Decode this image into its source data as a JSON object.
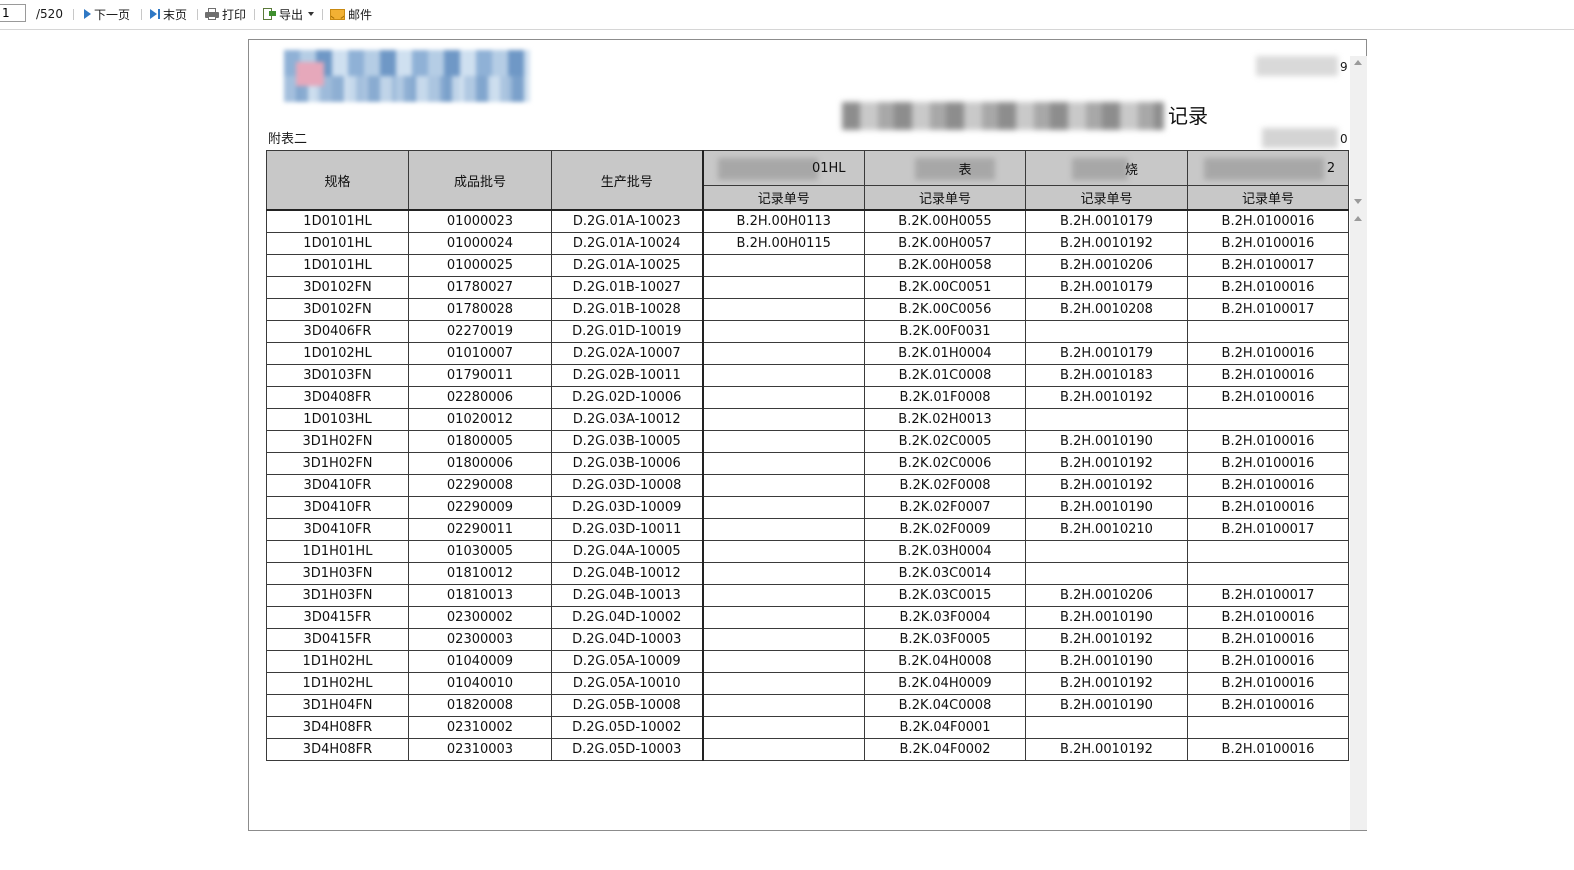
{
  "toolbar": {
    "page_input_value": "1",
    "page_total": "/520",
    "next_label": "下一页",
    "last_label": "末页",
    "print_label": "打印",
    "export_label": "导出",
    "mail_label": "邮件",
    "icons": [
      "next-page-icon",
      "last-page-icon",
      "printer-icon",
      "export-icon",
      "dropdown-caret-icon",
      "mail-icon"
    ],
    "accent_color": "#2f78c4"
  },
  "report": {
    "title_suffix": "记录",
    "page_mark_top": "9",
    "page_mark_bottom": "0",
    "attachment_label": "附表二",
    "header": {
      "spec": "规格",
      "product_batch": "成品批号",
      "production_batch": "生产批号",
      "group1_suffix": "01HL",
      "group2_suffix": "表",
      "group3_suffix": "烧",
      "group4_suffix": "2",
      "record_no": "记录单号"
    },
    "rows": [
      [
        "1D0101HL",
        "01000023",
        "D.2G.01A-10023",
        "B.2H.00H0113",
        "B.2K.00H0055",
        "B.2H.0010179",
        "B.2H.0100016"
      ],
      [
        "1D0101HL",
        "01000024",
        "D.2G.01A-10024",
        "B.2H.00H0115",
        "B.2K.00H0057",
        "B.2H.0010192",
        "B.2H.0100016"
      ],
      [
        "1D0101HL",
        "01000025",
        "D.2G.01A-10025",
        "",
        "B.2K.00H0058",
        "B.2H.0010206",
        "B.2H.0100017"
      ],
      [
        "3D0102FN",
        "01780027",
        "D.2G.01B-10027",
        "",
        "B.2K.00C0051",
        "B.2H.0010179",
        "B.2H.0100016"
      ],
      [
        "3D0102FN",
        "01780028",
        "D.2G.01B-10028",
        "",
        "B.2K.00C0056",
        "B.2H.0010208",
        "B.2H.0100017"
      ],
      [
        "3D0406FR",
        "02270019",
        "D.2G.01D-10019",
        "",
        "B.2K.00F0031",
        "",
        ""
      ],
      [
        "1D0102HL",
        "01010007",
        "D.2G.02A-10007",
        "",
        "B.2K.01H0004",
        "B.2H.0010179",
        "B.2H.0100016"
      ],
      [
        "3D0103FN",
        "01790011",
        "D.2G.02B-10011",
        "",
        "B.2K.01C0008",
        "B.2H.0010183",
        "B.2H.0100016"
      ],
      [
        "3D0408FR",
        "02280006",
        "D.2G.02D-10006",
        "",
        "B.2K.01F0008",
        "B.2H.0010192",
        "B.2H.0100016"
      ],
      [
        "1D0103HL",
        "01020012",
        "D.2G.03A-10012",
        "",
        "B.2K.02H0013",
        "",
        ""
      ],
      [
        "3D1H02FN",
        "01800005",
        "D.2G.03B-10005",
        "",
        "B.2K.02C0005",
        "B.2H.0010190",
        "B.2H.0100016"
      ],
      [
        "3D1H02FN",
        "01800006",
        "D.2G.03B-10006",
        "",
        "B.2K.02C0006",
        "B.2H.0010192",
        "B.2H.0100016"
      ],
      [
        "3D0410FR",
        "02290008",
        "D.2G.03D-10008",
        "",
        "B.2K.02F0008",
        "B.2H.0010192",
        "B.2H.0100016"
      ],
      [
        "3D0410FR",
        "02290009",
        "D.2G.03D-10009",
        "",
        "B.2K.02F0007",
        "B.2H.0010190",
        "B.2H.0100016"
      ],
      [
        "3D0410FR",
        "02290011",
        "D.2G.03D-10011",
        "",
        "B.2K.02F0009",
        "B.2H.0010210",
        "B.2H.0100017"
      ],
      [
        "1D1H01HL",
        "01030005",
        "D.2G.04A-10005",
        "",
        "B.2K.03H0004",
        "",
        ""
      ],
      [
        "3D1H03FN",
        "01810012",
        "D.2G.04B-10012",
        "",
        "B.2K.03C0014",
        "",
        ""
      ],
      [
        "3D1H03FN",
        "01810013",
        "D.2G.04B-10013",
        "",
        "B.2K.03C0015",
        "B.2H.0010206",
        "B.2H.0100017"
      ],
      [
        "3D0415FR",
        "02300002",
        "D.2G.04D-10002",
        "",
        "B.2K.03F0004",
        "B.2H.0010190",
        "B.2H.0100016"
      ],
      [
        "3D0415FR",
        "02300003",
        "D.2G.04D-10003",
        "",
        "B.2K.03F0005",
        "B.2H.0010192",
        "B.2H.0100016"
      ],
      [
        "1D1H02HL",
        "01040009",
        "D.2G.05A-10009",
        "",
        "B.2K.04H0008",
        "B.2H.0010190",
        "B.2H.0100016"
      ],
      [
        "1D1H02HL",
        "01040010",
        "D.2G.05A-10010",
        "",
        "B.2K.04H0009",
        "B.2H.0010192",
        "B.2H.0100016"
      ],
      [
        "3D1H04FN",
        "01820008",
        "D.2G.05B-10008",
        "",
        "B.2K.04C0008",
        "B.2H.0010190",
        "B.2H.0100016"
      ],
      [
        "3D4H08FR",
        "02310002",
        "D.2G.05D-10002",
        "",
        "B.2K.04F0001",
        "",
        ""
      ],
      [
        "3D4H08FR",
        "02310003",
        "D.2G.05D-10003",
        "",
        "B.2K.04F0002",
        "B.2H.0010192",
        "B.2H.0100016"
      ]
    ]
  }
}
